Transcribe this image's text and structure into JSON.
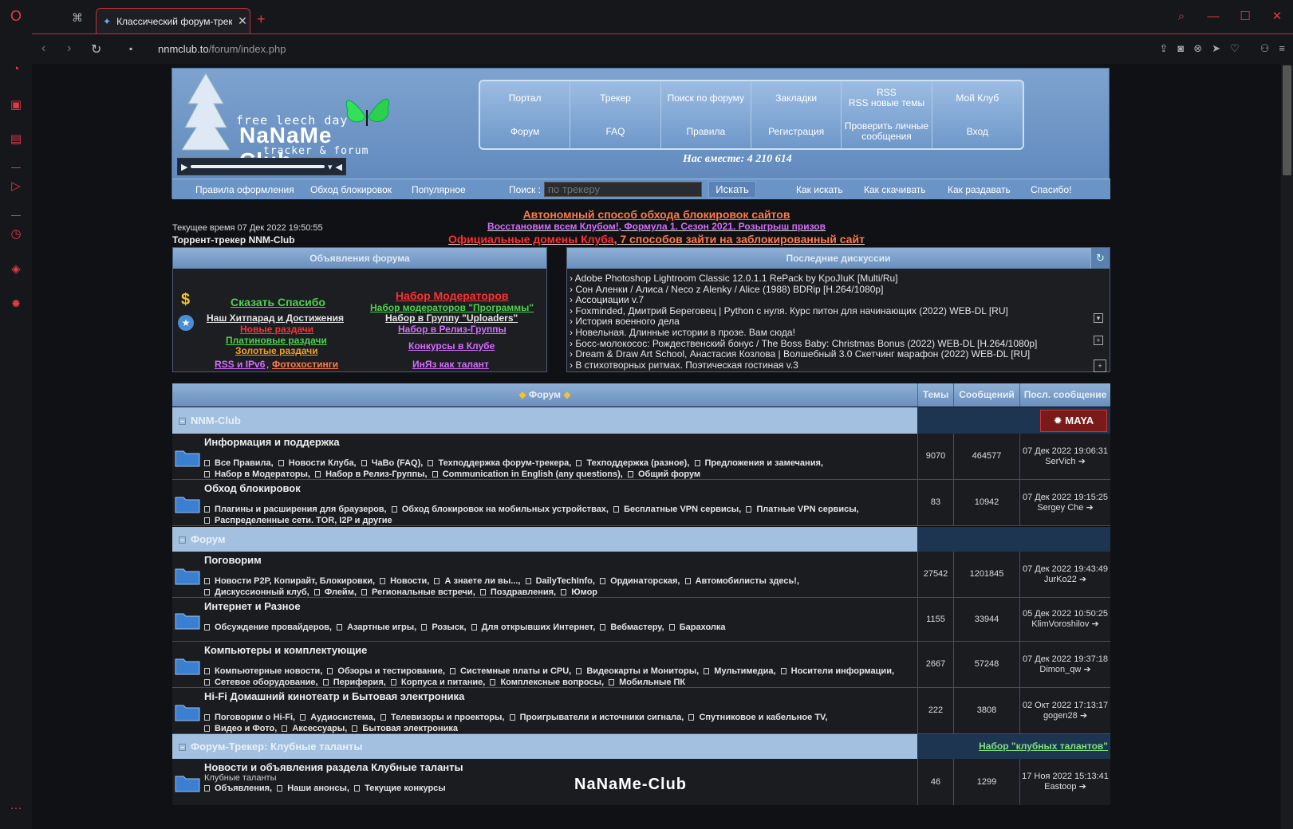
{
  "browser": {
    "tab_title": "Классический форум-трек",
    "new_tab": "+",
    "url_host": "nnmclub.to",
    "url_path": "/forum/index.php"
  },
  "header": {
    "logo_top": "free leech day",
    "logo_main": "NaNaMe Club",
    "logo_bottom": "tracker & forum",
    "nav_row1": [
      "Портал",
      "Трекер",
      "Поиск по форуму",
      "Закладки",
      "RSS\nRSS новые темы",
      "Мой Клуб"
    ],
    "nav_row2": [
      "Форум",
      "FAQ",
      "Правила",
      "Регистрация",
      "Проверить личные сообщения",
      "Вход"
    ],
    "together": "Нас вместе: 4 210 614",
    "sub_left": [
      "Правила оформления",
      "Обход блокировок",
      "Популярное"
    ],
    "search_label": "Поиск :",
    "search_placeholder": "по трекеру",
    "search_button": "Искать",
    "sub_right": [
      "Как искать",
      "Как скачивать",
      "Как раздавать",
      "Спасибо!"
    ]
  },
  "info": {
    "time": "Текущее время 07 Дек 2022 19:50:55",
    "title": "Торрент-трекер NNM-Club",
    "announce1": "Автономный способ обхода блокировок сайтов",
    "announce2a": "Восстановим всем Клубом!",
    "announce2b": "Формула 1. Сезон 2021. Розыгрыш призов",
    "announce3a": "Официальные домены Клуба",
    "announce3b": "7 способов зайти на заблокированный сайт"
  },
  "ann_panel": {
    "title": "Объявления форума",
    "left": [
      "Сказать Спасибо",
      "Наш Хитпарад и Достижения",
      "Новые раздачи",
      "Платиновые раздачи",
      "Золотые раздачи",
      "RSS и IPv6",
      "Фотохостинги"
    ],
    "right": [
      "Набор Модераторов",
      "Набор модераторов \"Программы\"",
      "Набор в Группу \"Uploaders\"",
      "Набор в Релиз-Группы",
      "Конкурсы в Клубе",
      "ИнЯз как талант"
    ],
    "dollar_icon": "$"
  },
  "disc_panel": {
    "title": "Последние дискуссии",
    "items": [
      "› Adobe Photoshop Lightroom Classic 12.0.1.1 RePack by KpoJIuK [Multi/Ru]",
      "› Сон Аленки / Алиса / Neco z Alenky / Alice (1988) BDRip [H.264/1080p]",
      "› Ассоциации v.7",
      "› Foxminded, Дмитрий Береговец | Python с нуля. Курс питон для начинающих (2022) WEB-DL [RU]",
      "› История военного дела",
      "› Новельная. Длинные истории в прозе. Вам сюда!",
      "› Босс-молокосос: Рождественский бонус / The Boss Baby: Christmas Bonus (2022) WEB-DL [H.264/1080p]",
      "› Dream & Draw Art School, Анастасия Козлова | Волшебный 3.0 Скетчинг марафон (2022) WEB-DL [RU]",
      "› В стихотворных ритмах. Поэтическая гостиная v.3"
    ]
  },
  "table": {
    "head_forum": "Форум",
    "head_topics": "Темы",
    "head_posts": "Сообщений",
    "head_last": "Посл. сообщение",
    "cat1": "NNM-Club",
    "cat2": "Форум",
    "cat3": "Форум-Трекер: Клубные таланты",
    "cat3_link": "Набор \"клубных талантов\"",
    "rows": [
      {
        "name": "Информация и поддержка",
        "subs": [
          "Все Правила,",
          "Новости Клуба,",
          "ЧаВо (FAQ),",
          "Техподдержка форум-трекера,",
          "Техподдержка (разное),",
          "Предложения и замечания,",
          "Набор в Модераторы,",
          "Набор в Релиз-Группы,",
          "Communication in English (any questions),",
          "Общий форум"
        ],
        "topics": "9070",
        "posts": "464577",
        "last_date": "07 Дек 2022 19:06:31",
        "last_user": "SerVich"
      },
      {
        "name": "Обход блокировок",
        "subs": [
          "Плагины и расширения для браузеров,",
          "Обход блокировок на мобильных устройствах,",
          "Бесплатные VPN сервисы,",
          "Платные VPN сервисы,",
          "Распределенные сети. TOR, I2P и другие"
        ],
        "topics": "83",
        "posts": "10942",
        "last_date": "07 Дек 2022 19:15:25",
        "last_user": "Sergey Che"
      },
      {
        "name": "Поговорим",
        "subs": [
          "Новости P2P, Копирайт, Блокировки,",
          "Новости,",
          "А знаете ли вы...,",
          "DailyTechInfo,",
          "Ординаторская,",
          "Автомобилисты здесь!,",
          "Дискуссионный клуб,",
          "Флейм,",
          "Региональные встречи,",
          "Поздравления,",
          "Юмор"
        ],
        "topics": "27542",
        "posts": "1201845",
        "last_date": "07 Дек 2022 19:43:49",
        "last_user": "JurKo22"
      },
      {
        "name": "Интернет и Разное",
        "subs": [
          "Обсуждение провайдеров,",
          "Азартные игры,",
          "Розыск,",
          "Для открывших Интернет,",
          "Вебмастеру,",
          "Барахолка"
        ],
        "topics": "1155",
        "posts": "33944",
        "last_date": "05 Дек 2022 10:50:25",
        "last_user": "KlimVoroshilov"
      },
      {
        "name": "Компьютеры и комплектующие",
        "subs": [
          "Компьютерные новости,",
          "Обзоры и тестирование,",
          "Системные платы и CPU,",
          "Видеокарты и Мониторы,",
          "Мультимедиа,",
          "Носители информации,",
          "Сетевое оборудование,",
          "Периферия,",
          "Корпуса и питание,",
          "Комплексные вопросы,",
          "Мобильные ПК"
        ],
        "topics": "2667",
        "posts": "57248",
        "last_date": "07 Дек 2022 19:37:18",
        "last_user": "Dimon_qw"
      },
      {
        "name": "Hi-Fi Домашний кинотеатр и Бытовая электроника",
        "subs": [
          "Поговорим о Hi-Fi,",
          "Аудиосистема,",
          "Телевизоры и проекторы,",
          "Проигрыватели и источники сигнала,",
          "Спутниковое и кабельное TV,",
          "Видео и Фото,",
          "Аксессуары,",
          "Бытовая электроника"
        ],
        "topics": "222",
        "posts": "3808",
        "last_date": "02 Окт 2022 17:13:17",
        "last_user": "gogen28"
      },
      {
        "name": "Новости и объявления раздела Клубные таланты",
        "desc": "Клубные таланты",
        "subs": [
          "Объявления,",
          "Наши анонсы,",
          "Текущие конкурсы"
        ],
        "topics": "46",
        "posts": "1299",
        "last_date": "17 Ноя 2022 15:13:41",
        "last_user": "Eastoop"
      }
    ]
  },
  "watermark": "NaNaMe-Club",
  "colors": {
    "accent": "#e03a48",
    "header_blue": "#6a93c6"
  }
}
